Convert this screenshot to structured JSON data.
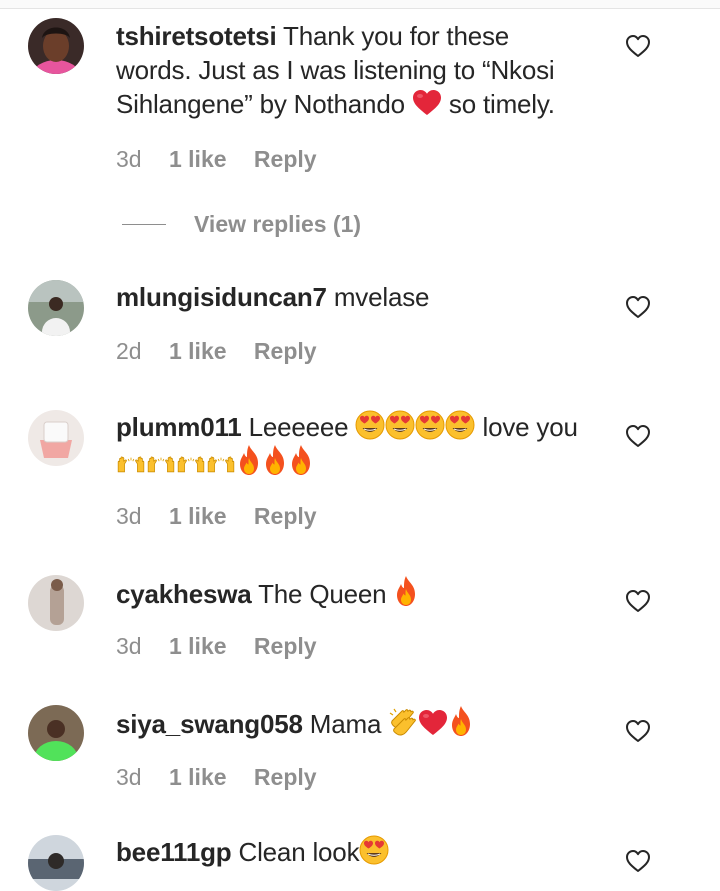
{
  "comments": [
    {
      "username": "tshiretsotetsi",
      "text_lines": [
        "Thank you for these",
        "words. Just as I was listening to “Nkosi",
        "Sihlangene” by Nothando",
        "so timely."
      ],
      "time": "3d",
      "likes": "1 like",
      "reply_label": "Reply"
    },
    {
      "username": "mlungisiduncan7",
      "text": "mvelase",
      "time": "2d",
      "likes": "1 like",
      "reply_label": "Reply"
    },
    {
      "username": "plumm011",
      "text": "Leeeeee",
      "text_after": "love you",
      "time": "3d",
      "likes": "1 like",
      "reply_label": "Reply"
    },
    {
      "username": "cyakheswa",
      "text": "The Queen",
      "time": "3d",
      "likes": "1 like",
      "reply_label": "Reply"
    },
    {
      "username": "siya_swang058",
      "text": "Mama",
      "time": "3d",
      "likes": "1 like",
      "reply_label": "Reply"
    },
    {
      "username": "bee111gp",
      "text": "Clean look"
    }
  ],
  "view_replies": "View replies (1)",
  "icons": {
    "like": "heart-outline-icon",
    "emojis": [
      "red-heart-emoji",
      "heart-eyes-emoji",
      "raising-hands-emoji",
      "fire-emoji",
      "clapping-hands-emoji"
    ]
  },
  "colors": {
    "text": "#262626",
    "meta": "#8e8e8e",
    "heart_red": "#e3263a",
    "fire": "#f4511e"
  }
}
